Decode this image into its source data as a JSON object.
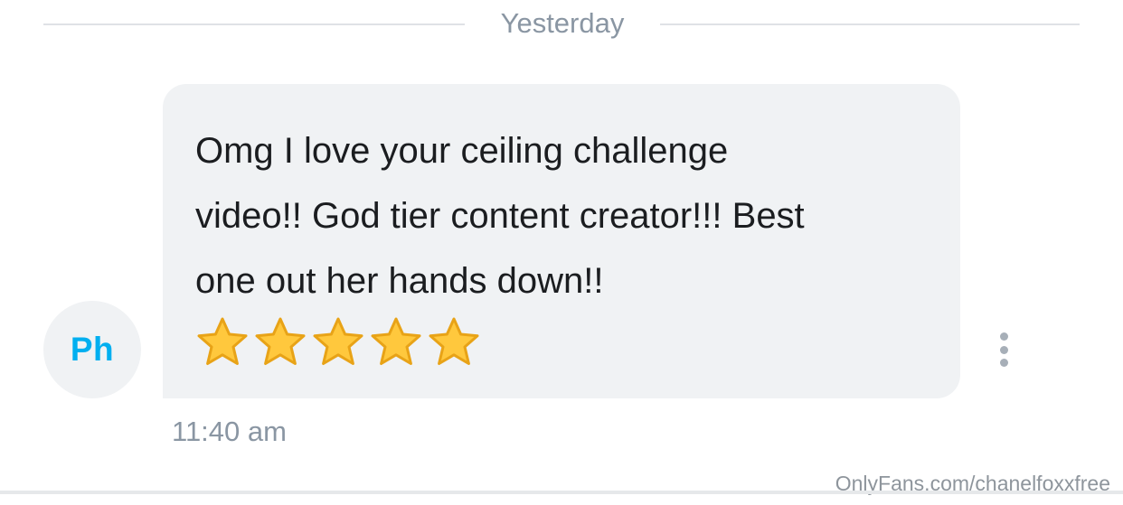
{
  "date_divider": {
    "label": "Yesterday"
  },
  "sender": {
    "avatar_initials": "Ph"
  },
  "message": {
    "text_lines": [
      "Omg I love your ceiling challenge",
      "video!! God tier content creator!!! Best",
      "one out her hands down!!"
    ],
    "emoji": [
      "star-emoji",
      "star-emoji",
      "star-emoji",
      "star-emoji",
      "star-emoji"
    ],
    "timestamp": "11:40 am"
  },
  "actions": {
    "more_icon": "vertical-ellipsis-icon"
  },
  "watermark": {
    "text": "OnlyFans.com/chanelfoxxfree"
  },
  "colors": {
    "accent": "#00aff0",
    "bubble": "#f0f2f4",
    "muted_text": "#8a96a3",
    "star_fill": "#ffc83d",
    "star_outline": "#e8a317"
  }
}
